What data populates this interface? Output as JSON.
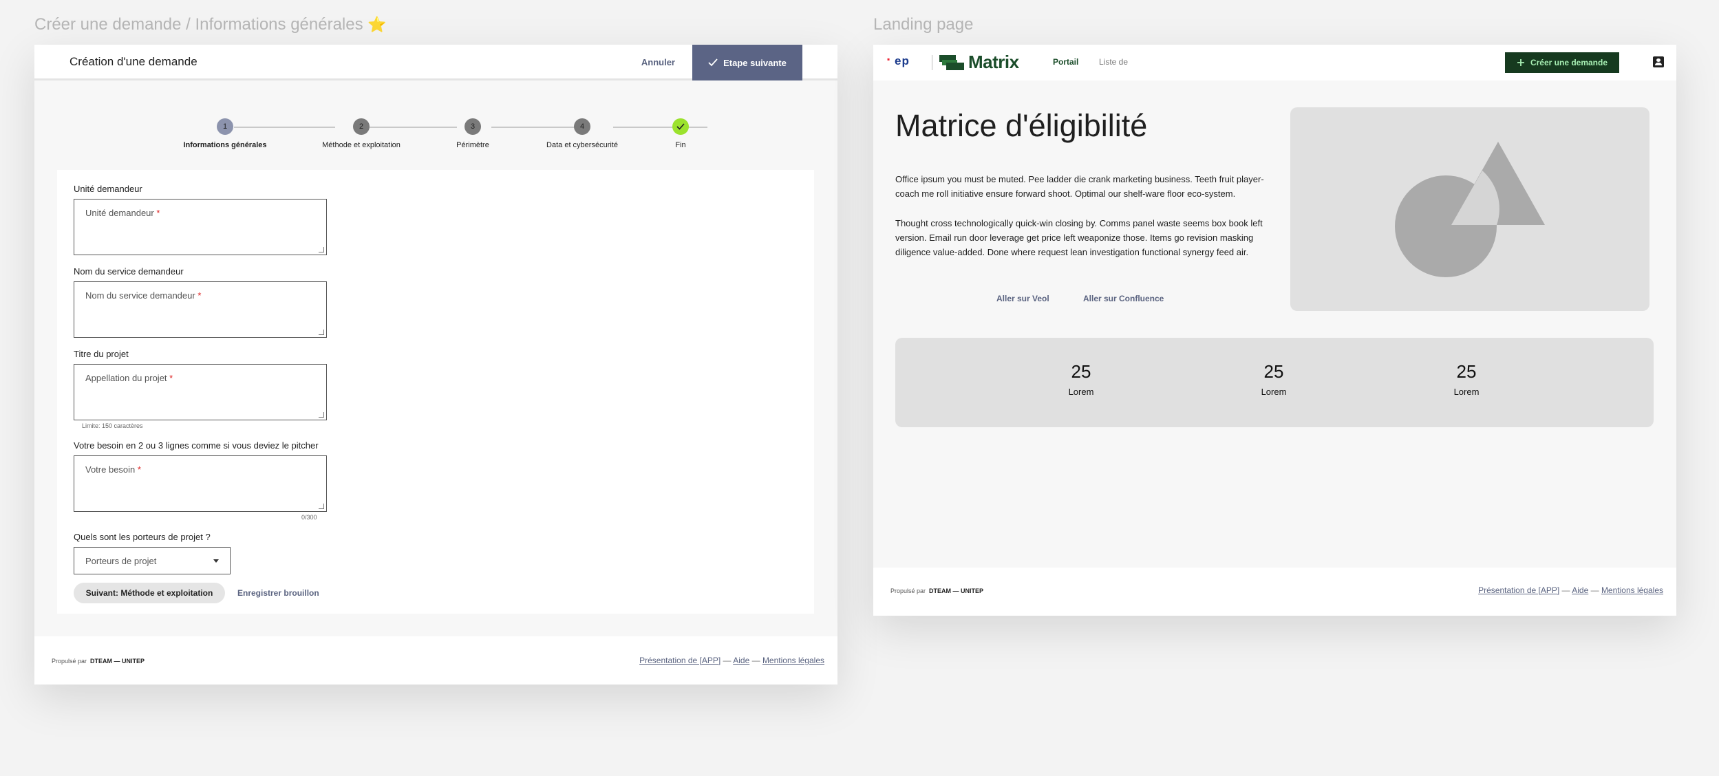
{
  "canvas": {
    "form_frame_title": "Créer une demande / Informations générales",
    "form_frame_title_icon": "⭐",
    "landing_frame_title": "Landing page"
  },
  "form": {
    "header": {
      "title": "Création d'une demande",
      "cancel_label": "Annuler",
      "next_label": "Etape suivante",
      "next_icon": "check-icon"
    },
    "steps": [
      {
        "number": "1",
        "label": "Informations générales",
        "state": "current"
      },
      {
        "number": "2",
        "label": "Méthode et exploitation",
        "state": "todo"
      },
      {
        "number": "3",
        "label": "Périmètre",
        "state": "todo"
      },
      {
        "number": "4",
        "label": "Data et cybersécurité",
        "state": "todo"
      },
      {
        "number": "",
        "label": "Fin",
        "state": "done"
      }
    ],
    "fields": {
      "unite": {
        "label": "Unité demandeur",
        "placeholder": "Unité demandeur",
        "required": "*"
      },
      "service": {
        "label": "Nom du service demandeur",
        "placeholder": "Nom du service demandeur",
        "required": "*"
      },
      "titre": {
        "label": "Titre du projet",
        "placeholder": "Appellation du projet",
        "required": "*",
        "hint": "Limite: 150 caractères"
      },
      "besoin": {
        "label": "Votre besoin en 2 ou 3 lignes comme si vous deviez le pitcher",
        "placeholder": "Votre besoin",
        "required": "*",
        "counter": "0/300"
      },
      "porteurs": {
        "label": "Quels sont les porteurs de projet ?",
        "placeholder": "Porteurs de projet"
      }
    },
    "actions": {
      "next_step_label": "Suivant: Méthode et exploitation",
      "draft_label": "Enregistrer brouillon"
    }
  },
  "footer": {
    "propelled_by": "Propulsé par",
    "team": "DTEAM — UNITEP",
    "link_presentation": "Présentation de [APP]",
    "link_help": "Aide",
    "link_legal": "Mentions légales",
    "separator": "—"
  },
  "landing": {
    "header": {
      "logo_text": "ep",
      "brand": "Matrix",
      "nav": [
        {
          "label": "Portail",
          "active": true
        },
        {
          "label": "Liste de",
          "active": false
        }
      ],
      "create_label": "Créer une demande",
      "create_icon": "plus-icon",
      "account_icon": "account-icon"
    },
    "hero": {
      "title": "Matrice d'éligibilité",
      "paragraph1": "Office ipsum you must be muted. Pee ladder die crank marketing business. Teeth fruit player-coach me roll initiative ensure forward shoot. Optimal our shelf-ware floor eco-system.",
      "paragraph2": "Thought cross technologically quick-win closing by. Comms panel waste seems box book left version. Email run door leverage get price left weaponize those. Items go revision masking diligence value-added. Done where request lean investigation functional synergy feed air.",
      "link_veol": "Aller sur Veol",
      "link_confluence": "Aller sur Confluence",
      "image_icon": "placeholder-shapes-icon"
    },
    "stats": [
      {
        "value": "25",
        "label": "Lorem"
      },
      {
        "value": "25",
        "label": "Lorem"
      },
      {
        "value": "25",
        "label": "Lorem"
      }
    ]
  },
  "colors": {
    "accent": "#5b6485",
    "brand_green": "#1b4d2a",
    "done_green": "#9be22d"
  }
}
